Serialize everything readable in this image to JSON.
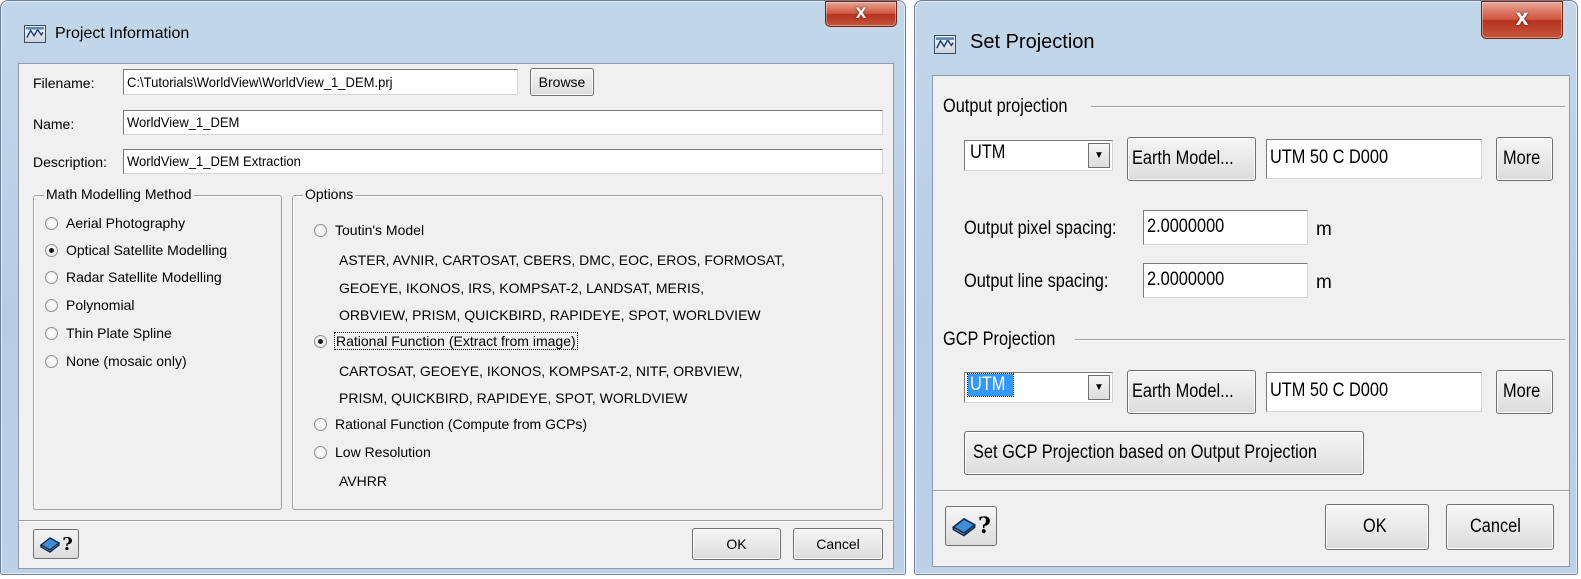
{
  "project_info": {
    "title": "Project Information",
    "close_glyph": "X",
    "filename_label": "Filename:",
    "filename_value": "C:\\Tutorials\\WorldView\\WorldView_1_DEM.prj",
    "browse_label": "Browse",
    "name_label": "Name:",
    "name_value": "WorldView_1_DEM",
    "description_label": "Description:",
    "description_value": "WorldView_1_DEM Extraction",
    "math_group_title": "Math Modelling Method",
    "math_methods": [
      {
        "label": "Aerial Photography",
        "selected": false
      },
      {
        "label": "Optical Satellite Modelling",
        "selected": true
      },
      {
        "label": "Radar Satellite Modelling",
        "selected": false
      },
      {
        "label": "Polynomial",
        "selected": false
      },
      {
        "label": "Thin Plate Spline",
        "selected": false
      },
      {
        "label": "None (mosaic only)",
        "selected": false
      }
    ],
    "options_group_title": "Options",
    "options": {
      "toutin_label": "Toutin's Model",
      "toutin_sensors": [
        "ASTER, AVNIR, CARTOSAT, CBERS, DMC, EOC, EROS, FORMOSAT,",
        "GEOEYE, IKONOS, IRS, KOMPSAT-2, LANDSAT, MERIS,",
        "ORBVIEW, PRISM, QUICKBIRD, RAPIDEYE, SPOT, WORLDVIEW"
      ],
      "rf_extract_label": "Rational Function (Extract from image)",
      "rf_extract_sensors": [
        "CARTOSAT, GEOEYE, IKONOS, KOMPSAT-2, NITF, ORBVIEW,",
        "PRISM, QUICKBIRD, RAPIDEYE, SPOT, WORLDVIEW"
      ],
      "rf_compute_label": "Rational Function (Compute from GCPs)",
      "low_res_label": "Low Resolution",
      "low_res_sensors": [
        "AVHRR"
      ],
      "selected": "rf_extract"
    },
    "help_glyph": "?",
    "ok_label": "OK",
    "cancel_label": "Cancel"
  },
  "set_projection": {
    "title": "Set Projection",
    "close_glyph": "X",
    "output_group_title": "Output projection",
    "output_projection_value": "UTM",
    "earth_model_label": "Earth Model...",
    "output_zone_value": "UTM    50 C D000",
    "more_label": "More",
    "pixel_spacing_label": "Output pixel spacing:",
    "pixel_spacing_value": "2.0000000",
    "pixel_unit": "m",
    "line_spacing_label": "Output line spacing:",
    "line_spacing_value": "2.0000000",
    "line_unit": "m",
    "gcp_group_title": "GCP Projection",
    "gcp_projection_value": "UTM",
    "gcp_earth_model_label": "Earth Model...",
    "gcp_zone_value": "UTM    50 C D000",
    "gcp_more_label": "More",
    "set_gcp_button_label": "Set GCP Projection based on Output Projection",
    "help_glyph": "?",
    "ok_label": "OK",
    "cancel_label": "Cancel"
  },
  "icons": {
    "app_icon": "app-icon",
    "help_book_icon": "help-book-icon",
    "dropdown_arrow": "▼"
  },
  "colors": {
    "frame": "#b6cde4",
    "client": "#f0f0f0",
    "close_button": "#c7543a",
    "selection": "#3399ff"
  }
}
